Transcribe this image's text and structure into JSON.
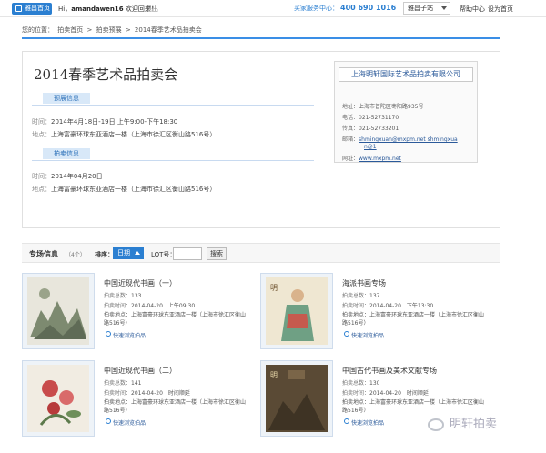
{
  "topbar": {
    "home_label": "雅昌首页",
    "welcome_prefix": "Hi，",
    "username": "amandawen16",
    "welcome_suffix": "欢迎回来！",
    "logout": "退出",
    "service_label": "买家服务中心：",
    "service_phone": "400 690 1016",
    "site_select": "雅昌子站",
    "help": "帮助中心",
    "set_home": "设为首页"
  },
  "breadcrumb": {
    "prefix": "您的位置：",
    "items": [
      "拍卖首页",
      "拍卖预展",
      "2014春季艺术品拍卖会"
    ],
    "separator": ">"
  },
  "auction": {
    "title": "2014春季艺术品拍卖会",
    "preview": {
      "tag": "预展信息",
      "time_label": "时间：",
      "time_value": "2014年4月18日-19日 上午9:00-下午18:30",
      "place_label": "地点：",
      "place_value": "上海富豪环球东亚酒店一楼（上海市徐汇区衡山路516号）"
    },
    "sale": {
      "tag": "拍卖信息",
      "time_label": "时间：",
      "time_value": "2014年04月20日",
      "place_label": "地点：",
      "place_value": "上海富豪环球东亚酒店一楼（上海市徐汇区衡山路516号）"
    }
  },
  "company": {
    "name": "上海明轩国际艺术品拍卖有限公司",
    "address_label": "地址：",
    "address": "上海市普陀区枣阳路935号",
    "phone_label": "电话：",
    "phone": "021-52731170",
    "fax_label": "传真：",
    "fax": "021-52733201",
    "email_label": "邮箱：",
    "email_line1": "shmingxuan@mxpm.net shmingxua",
    "email_line2": "n@1",
    "web_label": "网址：",
    "web": "www.mxpm.net"
  },
  "special": {
    "title": "专场信息",
    "count": "（4个）",
    "sort_label": "排序：",
    "sort_value": "日期",
    "lot_label": "LOT号：",
    "lot_value": "",
    "search": "搜索"
  },
  "cards": [
    {
      "title": "中国近现代书画（一）",
      "total_label": "拍卖总数：",
      "total": "133",
      "time_label": "拍卖时间：",
      "time": "2014-04-20　上午09:30",
      "addr_label": "拍卖地点：",
      "addr": "上海富豪环球东亚酒店一楼（上海市徐汇区衡山路516号）",
      "browse": "快速浏览拍品"
    },
    {
      "title": "海派书画专场",
      "total_label": "拍卖总数：",
      "total": "137",
      "time_label": "拍卖时间：",
      "time": "2014-04-20　下午13:30",
      "addr_label": "拍卖地点：",
      "addr": "上海富豪环球东亚酒店一楼（上海市徐汇区衡山路516号）",
      "browse": "快速浏览拍品"
    },
    {
      "title": "中国近现代书画（二）",
      "total_label": "拍卖总数：",
      "total": "141",
      "time_label": "拍卖时间：",
      "time": "2014-04-20　时间顺延",
      "addr_label": "拍卖地点：",
      "addr": "上海富豪环球东亚酒店一楼（上海市徐汇区衡山路516号）",
      "browse": "快速浏览拍品"
    },
    {
      "title": "中国古代书画及美术文献专场",
      "total_label": "拍卖总数：",
      "total": "130",
      "time_label": "拍卖时间：",
      "time": "2014-04-20　时间顺延",
      "addr_label": "拍卖地点：",
      "addr": "上海富豪环球东亚酒店一楼（上海市徐汇区衡山路516号）",
      "browse": "快速浏览拍品"
    }
  ],
  "watermark": "明轩拍卖",
  "colors": {
    "accent": "#2b7fd1",
    "tag_bg": "#d8e8f8",
    "link": "#2b5a9a"
  }
}
